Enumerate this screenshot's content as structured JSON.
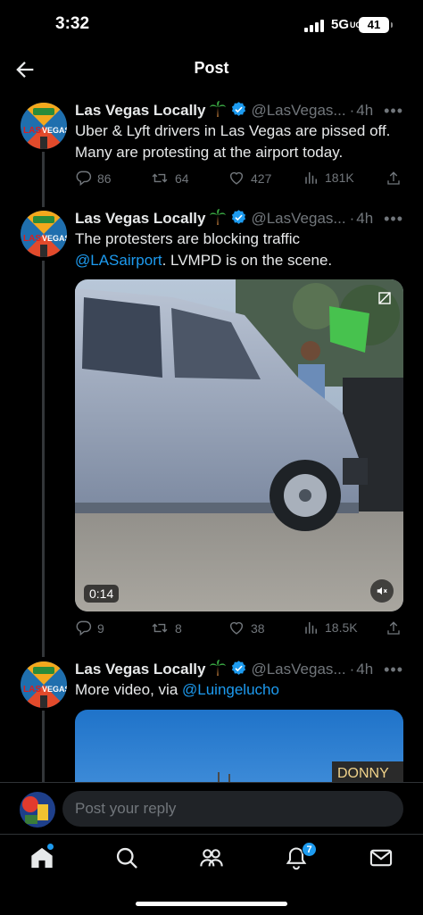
{
  "status_bar": {
    "time": "3:32",
    "network": "5G",
    "network_suffix": "UC",
    "battery": "41"
  },
  "header": {
    "title": "Post"
  },
  "posts": [
    {
      "author": "Las Vegas Locally",
      "handle": "@LasVegas...",
      "separator": "·",
      "time": "4h",
      "text_lines": [
        "Uber & Lyft drivers in Las Vegas are pissed off.",
        "Many are protesting at the airport today."
      ],
      "stats": {
        "replies": "86",
        "reposts": "64",
        "likes": "427",
        "views": "181K"
      }
    },
    {
      "author": "Las Vegas Locally",
      "handle": "@LasVegas...",
      "separator": "·",
      "time": "4h",
      "text_line1": "The protesters are blocking traffic",
      "mention": "@LASairport",
      "text_after_mention": ". LVMPD is on the scene.",
      "video": {
        "duration": "0:14"
      },
      "stats": {
        "replies": "9",
        "reposts": "8",
        "likes": "38",
        "views": "18.5K"
      }
    },
    {
      "author": "Las Vegas Locally",
      "handle": "@LasVegas...",
      "separator": "·",
      "time": "4h",
      "text_prefix": "More video, via ",
      "mention": "@Luingelucho",
      "media_sign": "DONNY"
    }
  ],
  "reply": {
    "placeholder": "Post your reply"
  },
  "tabbar": {
    "notifications_count": "7"
  },
  "avatar_text": {
    "left": "LAS",
    "right": "VEGAS"
  },
  "colors": {
    "accent": "#1d9bf0",
    "muted": "#71767b",
    "background": "#000000",
    "text": "#e7e9ea"
  }
}
